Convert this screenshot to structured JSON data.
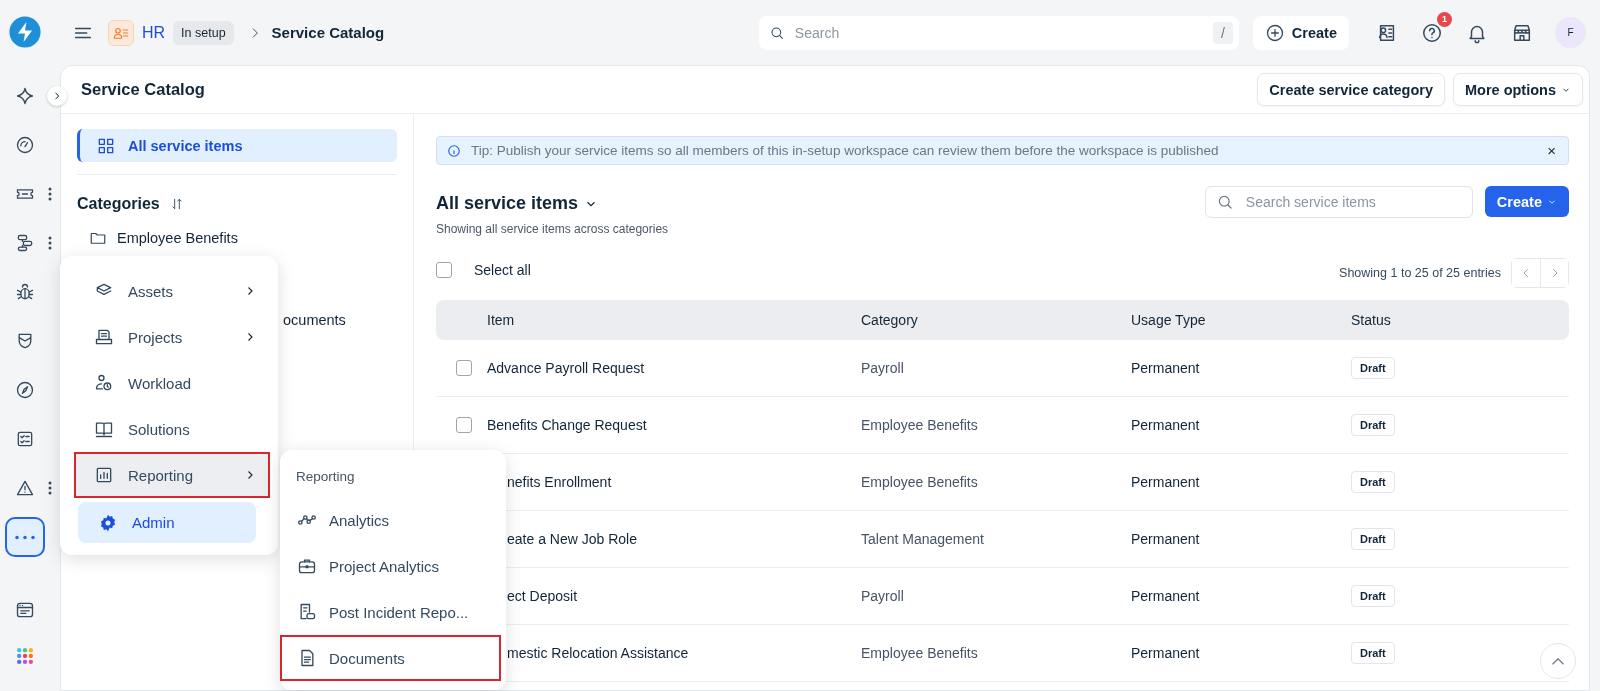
{
  "topbar": {
    "workspace": "HR",
    "workspace_status": "In setup",
    "breadcrumb": "Service Catalog",
    "search": {
      "placeholder": "Search",
      "shortcut": "/"
    },
    "create_button": "Create",
    "help_badge": "1",
    "avatar": "F"
  },
  "rail": [
    {
      "selected": false,
      "kebab": false
    },
    {
      "selected": false,
      "kebab": false
    },
    {
      "selected": false,
      "kebab": true
    },
    {
      "selected": false,
      "kebab": true
    },
    {
      "selected": false,
      "kebab": false
    },
    {
      "selected": false,
      "kebab": false
    },
    {
      "selected": false,
      "kebab": false
    },
    {
      "selected": false,
      "kebab": false
    },
    {
      "selected": false,
      "kebab": true
    },
    {
      "selected": true,
      "kebab": false
    },
    {
      "selected": false,
      "kebab": false
    },
    {
      "selected": false,
      "kebab": false
    }
  ],
  "page": {
    "title": "Service Catalog",
    "buttons": [
      {
        "label": "Create service category",
        "dropdown": false
      },
      {
        "label": "More options",
        "dropdown": true
      }
    ]
  },
  "sidebar": {
    "items": [
      {
        "label": "All service items",
        "selected": true
      }
    ],
    "categories_title": "Categories",
    "categories": [
      {
        "label": "Employee Benefits",
        "covered": false
      },
      {
        "label": "ocuments",
        "covered": true
      }
    ]
  },
  "tip": {
    "text": "Tip: Publish your service items so all members of this in-setup workspace can review them before the workspace is published",
    "close": "×"
  },
  "list": {
    "title": "All service items",
    "subtitle": "Showing all service items across categories",
    "search": {
      "placeholder": "Search service items"
    },
    "create_button": "Create",
    "select_all": {
      "label": "Select all",
      "checked": false
    },
    "entries": "Showing 1 to 25 of 25 entries"
  },
  "table": {
    "columns": [
      "Item",
      "Category",
      "Usage Type",
      "Status"
    ],
    "rows": [
      {
        "item": "Advance Payroll Request",
        "category": "Payroll",
        "usage_type": "Permanent",
        "status": "Draft",
        "covered": false,
        "checked": false
      },
      {
        "item": "Benefits Change Request",
        "category": "Employee Benefits",
        "usage_type": "Permanent",
        "status": "Draft",
        "covered": false,
        "checked": false
      },
      {
        "item": "nefits Enrollment",
        "category": "Employee Benefits",
        "usage_type": "Permanent",
        "status": "Draft",
        "covered": true
      },
      {
        "item": "eate a New Job Role",
        "category": "Talent Management",
        "usage_type": "Permanent",
        "status": "Draft",
        "covered": true
      },
      {
        "item": "ect Deposit",
        "category": "Payroll",
        "usage_type": "Permanent",
        "status": "Draft",
        "covered": true
      },
      {
        "item": "mestic Relocation Assistance",
        "category": "Employee Benefits",
        "usage_type": "Permanent",
        "status": "Draft",
        "covered": true
      }
    ]
  },
  "nav_menu": {
    "items": [
      {
        "label": "Assets",
        "submenu": true,
        "selected": false,
        "expanded": false,
        "highlighted": false
      },
      {
        "label": "Projects",
        "submenu": true,
        "selected": false,
        "expanded": false,
        "highlighted": false
      },
      {
        "label": "Workload",
        "submenu": false,
        "selected": false,
        "expanded": false,
        "highlighted": false
      },
      {
        "label": "Solutions",
        "submenu": false,
        "selected": false,
        "expanded": false,
        "highlighted": false
      },
      {
        "label": "Reporting",
        "submenu": true,
        "selected": false,
        "expanded": true,
        "highlighted": true
      },
      {
        "label": "Admin",
        "submenu": false,
        "selected": true,
        "expanded": false,
        "highlighted": false
      }
    ]
  },
  "submenu": {
    "title": "Reporting",
    "items": [
      {
        "label": "Analytics",
        "selected": false,
        "highlighted": false
      },
      {
        "label": "Project Analytics",
        "selected": false,
        "highlighted": false
      },
      {
        "label": "Post Incident Repo...",
        "selected": false,
        "highlighted": false
      },
      {
        "label": "Documents",
        "selected": false,
        "highlighted": true
      }
    ]
  }
}
